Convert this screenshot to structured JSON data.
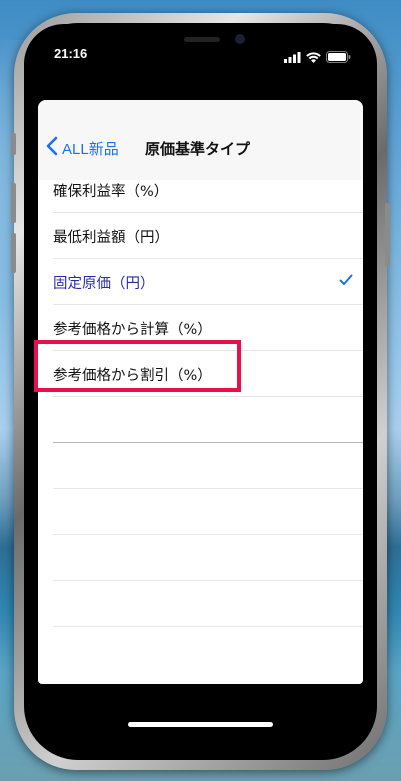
{
  "status": {
    "time": "21:16"
  },
  "nav": {
    "back_label": "ALL新品",
    "title": "原価基準タイプ"
  },
  "options": [
    {
      "label": "確保利益率（%）",
      "selected": false
    },
    {
      "label": "最低利益額（円）",
      "selected": false
    },
    {
      "label": "固定原価（円）",
      "selected": true
    },
    {
      "label": "参考価格から計算（%）",
      "selected": false
    },
    {
      "label": "参考価格から割引（%）",
      "selected": false
    }
  ],
  "colors": {
    "accent": "#1a73e8",
    "selected_text": "#2b2aa8",
    "highlight": "#e8104a"
  }
}
